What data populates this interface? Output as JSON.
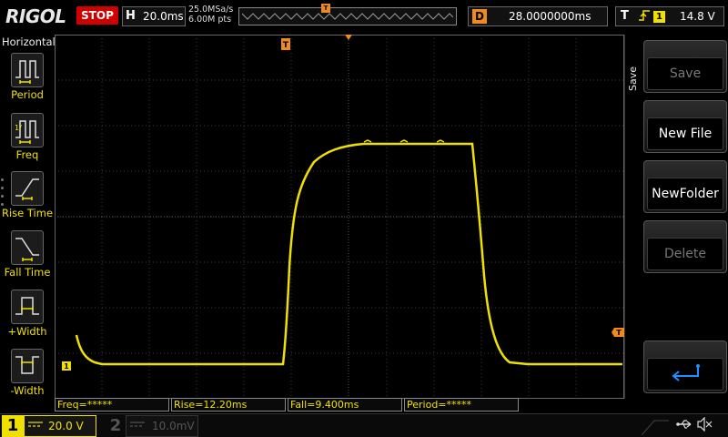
{
  "top": {
    "brand": "RIGOL",
    "run_state": "STOP",
    "horizontal_letter": "H",
    "timebase": "20.0ms",
    "sample_rate": "25.0MSa/s",
    "memory_depth": "6.00M pts",
    "memory_trigger_marker": "T",
    "delay_letter": "D",
    "delay": "28.0000000ms",
    "trigger_letter": "T",
    "trigger_edge_icon": "rising-edge-icon",
    "trigger_source": "1",
    "trigger_level": "14.8 V"
  },
  "left_panel": {
    "title": "Horizontal",
    "items": [
      {
        "label": "Period",
        "icon": "period-icon"
      },
      {
        "label": "Freq",
        "icon": "freq-icon"
      },
      {
        "label": "Rise Time",
        "icon": "rise-time-icon"
      },
      {
        "label": "Fall Time",
        "icon": "fall-time-icon"
      },
      {
        "label": "+Width",
        "icon": "pos-width-icon"
      },
      {
        "label": "-Width",
        "icon": "neg-width-icon"
      }
    ]
  },
  "screen": {
    "trigger_marker": "T",
    "ch1_marker": "1",
    "level_marker": "T"
  },
  "right_menu": {
    "tab_label": "Save",
    "buttons": [
      {
        "label": "Save",
        "enabled": false
      },
      {
        "label": "New File",
        "enabled": true
      },
      {
        "label": "NewFolder",
        "enabled": true
      },
      {
        "label": "Delete",
        "enabled": false
      }
    ],
    "return_icon": "return-icon"
  },
  "measurements": [
    {
      "text": "Freq=*****"
    },
    {
      "text": "Rise=12.20ms"
    },
    {
      "text": "Fall=9.400ms"
    },
    {
      "text": "Period=*****"
    }
  ],
  "channels": {
    "ch1": {
      "number": "1",
      "coupling_icon": "dc-coupling-icon",
      "scale": "20.0 V",
      "color": "#f0e000"
    },
    "ch2": {
      "number": "2",
      "coupling_icon": "dc-coupling-icon",
      "scale": "10.0mV",
      "color": "#555555"
    }
  },
  "status_icons": {
    "usb": "usb-icon",
    "sound": "mute-icon"
  },
  "colors": {
    "ch1": "#f0e000",
    "accent": "#f08a1a",
    "stop": "#d00000",
    "return": "#1e90ff"
  }
}
